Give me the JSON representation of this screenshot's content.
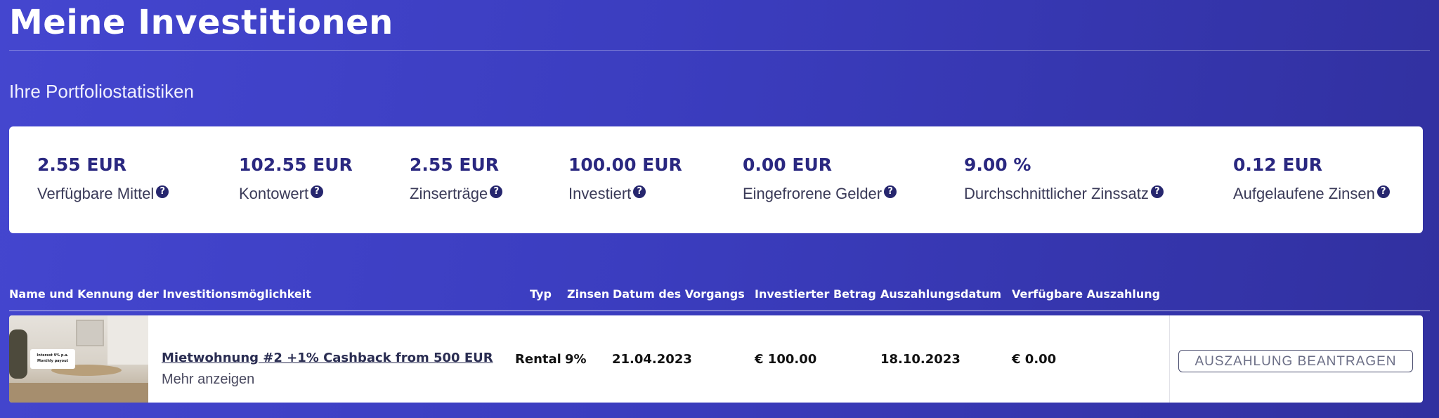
{
  "page": {
    "title": "Meine Investitionen",
    "subtitle": "Ihre Portfoliostatistiken"
  },
  "stats": [
    {
      "value": "2.55 EUR",
      "label": "Verfügbare Mittel"
    },
    {
      "value": "102.55 EUR",
      "label": "Kontowert"
    },
    {
      "value": "2.55 EUR",
      "label": "Zinserträge"
    },
    {
      "value": "100.00 EUR",
      "label": "Investiert"
    },
    {
      "value": "0.00 EUR",
      "label": "Eingefrorene Gelder"
    },
    {
      "value": "9.00 %",
      "label": "Durchschnittlicher Zinssatz"
    },
    {
      "value": "0.12 EUR",
      "label": "Aufgelaufene Zinsen"
    }
  ],
  "help_icon_glyph": "?",
  "table": {
    "columns": [
      "Name und Kennung der Investitionsmöglichkeit",
      "Typ",
      "Zinsen",
      "Datum des Vorgangs",
      "Investierter Betrag",
      "Auszahlungsdatum",
      "Verfügbare Auszahlung"
    ],
    "rows": [
      {
        "thumbnail_badge": "Interest 9% p.a. Monthly payout",
        "name": "Mietwohnung #2 +1% Cashback from 500 EUR",
        "show_more": "Mehr anzeigen",
        "type": "Rental",
        "interest": "9%",
        "transaction_date": "21.04.2023",
        "invested_amount": "€ 100.00",
        "payout_date": "18.10.2023",
        "available_payout": "€ 0.00",
        "action_label": "AUSZAHLUNG BEANTRAGEN"
      }
    ]
  },
  "colors": {
    "background_start": "#4446cf",
    "background_end": "#31309f",
    "stat_value": "#2a2880",
    "help_icon": "#26266e"
  }
}
